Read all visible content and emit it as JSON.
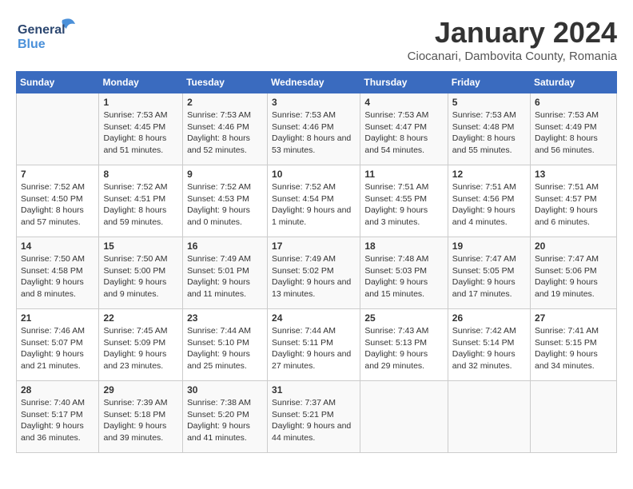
{
  "header": {
    "logo_general": "General",
    "logo_blue": "Blue",
    "month_title": "January 2024",
    "location": "Ciocanari, Dambovita County, Romania"
  },
  "weekdays": [
    "Sunday",
    "Monday",
    "Tuesday",
    "Wednesday",
    "Thursday",
    "Friday",
    "Saturday"
  ],
  "weeks": [
    [
      {
        "day": "",
        "sunrise": "",
        "sunset": "",
        "daylight": ""
      },
      {
        "day": "1",
        "sunrise": "Sunrise: 7:53 AM",
        "sunset": "Sunset: 4:45 PM",
        "daylight": "Daylight: 8 hours and 51 minutes."
      },
      {
        "day": "2",
        "sunrise": "Sunrise: 7:53 AM",
        "sunset": "Sunset: 4:46 PM",
        "daylight": "Daylight: 8 hours and 52 minutes."
      },
      {
        "day": "3",
        "sunrise": "Sunrise: 7:53 AM",
        "sunset": "Sunset: 4:46 PM",
        "daylight": "Daylight: 8 hours and 53 minutes."
      },
      {
        "day": "4",
        "sunrise": "Sunrise: 7:53 AM",
        "sunset": "Sunset: 4:47 PM",
        "daylight": "Daylight: 8 hours and 54 minutes."
      },
      {
        "day": "5",
        "sunrise": "Sunrise: 7:53 AM",
        "sunset": "Sunset: 4:48 PM",
        "daylight": "Daylight: 8 hours and 55 minutes."
      },
      {
        "day": "6",
        "sunrise": "Sunrise: 7:53 AM",
        "sunset": "Sunset: 4:49 PM",
        "daylight": "Daylight: 8 hours and 56 minutes."
      }
    ],
    [
      {
        "day": "7",
        "sunrise": "Sunrise: 7:52 AM",
        "sunset": "Sunset: 4:50 PM",
        "daylight": "Daylight: 8 hours and 57 minutes."
      },
      {
        "day": "8",
        "sunrise": "Sunrise: 7:52 AM",
        "sunset": "Sunset: 4:51 PM",
        "daylight": "Daylight: 8 hours and 59 minutes."
      },
      {
        "day": "9",
        "sunrise": "Sunrise: 7:52 AM",
        "sunset": "Sunset: 4:53 PM",
        "daylight": "Daylight: 9 hours and 0 minutes."
      },
      {
        "day": "10",
        "sunrise": "Sunrise: 7:52 AM",
        "sunset": "Sunset: 4:54 PM",
        "daylight": "Daylight: 9 hours and 1 minute."
      },
      {
        "day": "11",
        "sunrise": "Sunrise: 7:51 AM",
        "sunset": "Sunset: 4:55 PM",
        "daylight": "Daylight: 9 hours and 3 minutes."
      },
      {
        "day": "12",
        "sunrise": "Sunrise: 7:51 AM",
        "sunset": "Sunset: 4:56 PM",
        "daylight": "Daylight: 9 hours and 4 minutes."
      },
      {
        "day": "13",
        "sunrise": "Sunrise: 7:51 AM",
        "sunset": "Sunset: 4:57 PM",
        "daylight": "Daylight: 9 hours and 6 minutes."
      }
    ],
    [
      {
        "day": "14",
        "sunrise": "Sunrise: 7:50 AM",
        "sunset": "Sunset: 4:58 PM",
        "daylight": "Daylight: 9 hours and 8 minutes."
      },
      {
        "day": "15",
        "sunrise": "Sunrise: 7:50 AM",
        "sunset": "Sunset: 5:00 PM",
        "daylight": "Daylight: 9 hours and 9 minutes."
      },
      {
        "day": "16",
        "sunrise": "Sunrise: 7:49 AM",
        "sunset": "Sunset: 5:01 PM",
        "daylight": "Daylight: 9 hours and 11 minutes."
      },
      {
        "day": "17",
        "sunrise": "Sunrise: 7:49 AM",
        "sunset": "Sunset: 5:02 PM",
        "daylight": "Daylight: 9 hours and 13 minutes."
      },
      {
        "day": "18",
        "sunrise": "Sunrise: 7:48 AM",
        "sunset": "Sunset: 5:03 PM",
        "daylight": "Daylight: 9 hours and 15 minutes."
      },
      {
        "day": "19",
        "sunrise": "Sunrise: 7:47 AM",
        "sunset": "Sunset: 5:05 PM",
        "daylight": "Daylight: 9 hours and 17 minutes."
      },
      {
        "day": "20",
        "sunrise": "Sunrise: 7:47 AM",
        "sunset": "Sunset: 5:06 PM",
        "daylight": "Daylight: 9 hours and 19 minutes."
      }
    ],
    [
      {
        "day": "21",
        "sunrise": "Sunrise: 7:46 AM",
        "sunset": "Sunset: 5:07 PM",
        "daylight": "Daylight: 9 hours and 21 minutes."
      },
      {
        "day": "22",
        "sunrise": "Sunrise: 7:45 AM",
        "sunset": "Sunset: 5:09 PM",
        "daylight": "Daylight: 9 hours and 23 minutes."
      },
      {
        "day": "23",
        "sunrise": "Sunrise: 7:44 AM",
        "sunset": "Sunset: 5:10 PM",
        "daylight": "Daylight: 9 hours and 25 minutes."
      },
      {
        "day": "24",
        "sunrise": "Sunrise: 7:44 AM",
        "sunset": "Sunset: 5:11 PM",
        "daylight": "Daylight: 9 hours and 27 minutes."
      },
      {
        "day": "25",
        "sunrise": "Sunrise: 7:43 AM",
        "sunset": "Sunset: 5:13 PM",
        "daylight": "Daylight: 9 hours and 29 minutes."
      },
      {
        "day": "26",
        "sunrise": "Sunrise: 7:42 AM",
        "sunset": "Sunset: 5:14 PM",
        "daylight": "Daylight: 9 hours and 32 minutes."
      },
      {
        "day": "27",
        "sunrise": "Sunrise: 7:41 AM",
        "sunset": "Sunset: 5:15 PM",
        "daylight": "Daylight: 9 hours and 34 minutes."
      }
    ],
    [
      {
        "day": "28",
        "sunrise": "Sunrise: 7:40 AM",
        "sunset": "Sunset: 5:17 PM",
        "daylight": "Daylight: 9 hours and 36 minutes."
      },
      {
        "day": "29",
        "sunrise": "Sunrise: 7:39 AM",
        "sunset": "Sunset: 5:18 PM",
        "daylight": "Daylight: 9 hours and 39 minutes."
      },
      {
        "day": "30",
        "sunrise": "Sunrise: 7:38 AM",
        "sunset": "Sunset: 5:20 PM",
        "daylight": "Daylight: 9 hours and 41 minutes."
      },
      {
        "day": "31",
        "sunrise": "Sunrise: 7:37 AM",
        "sunset": "Sunset: 5:21 PM",
        "daylight": "Daylight: 9 hours and 44 minutes."
      },
      {
        "day": "",
        "sunrise": "",
        "sunset": "",
        "daylight": ""
      },
      {
        "day": "",
        "sunrise": "",
        "sunset": "",
        "daylight": ""
      },
      {
        "day": "",
        "sunrise": "",
        "sunset": "",
        "daylight": ""
      }
    ]
  ]
}
